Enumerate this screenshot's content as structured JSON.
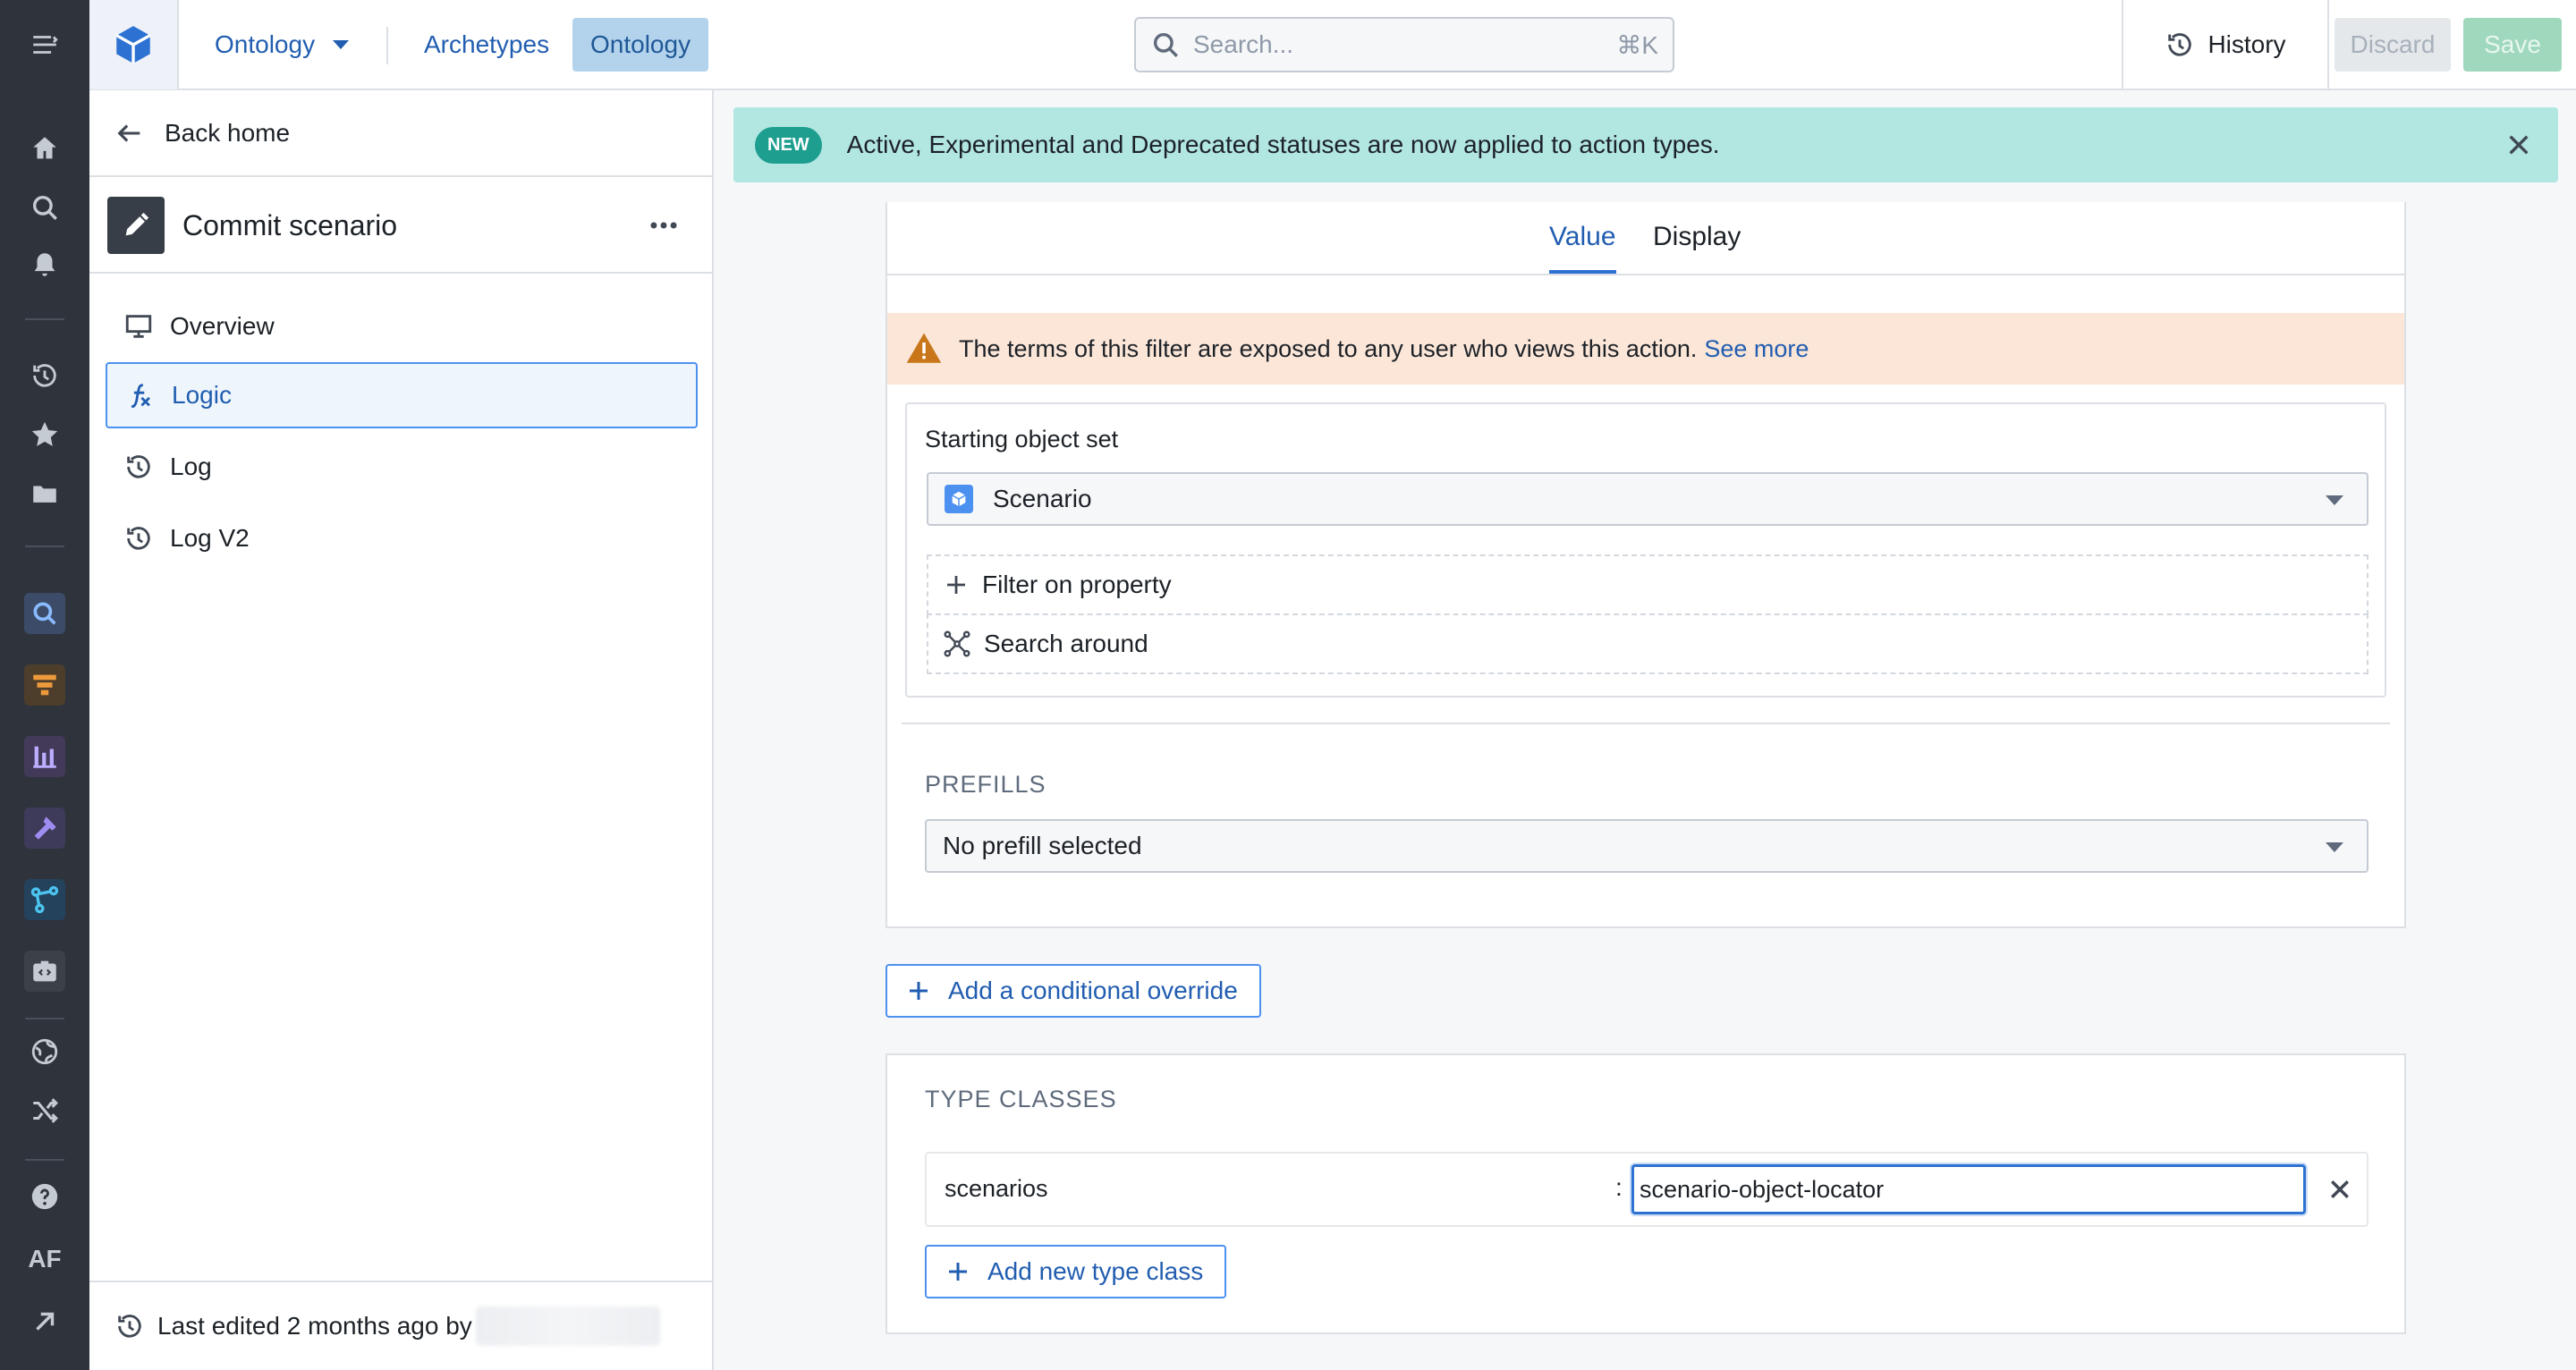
{
  "topbar": {
    "ontology_menu": "Ontology",
    "tab_archetypes": "Archetypes",
    "tab_ontology": "Ontology",
    "search_placeholder": "Search...",
    "search_shortcut": "⌘K",
    "history": "History",
    "discard": "Discard",
    "save": "Save"
  },
  "rail": {
    "initials": "AF",
    "icons": [
      "menu-icon",
      "home-icon",
      "search-icon",
      "bell-icon",
      "history-icon",
      "star-icon",
      "folder-icon",
      "object-explorer-icon",
      "pipeline-icon",
      "analytics-icon",
      "hammer-icon",
      "graph-icon",
      "code-workspace-icon",
      "globe-icon",
      "shuffle-icon",
      "help-icon",
      "external-link-icon"
    ]
  },
  "sidebar": {
    "back": "Back home",
    "action_title": "Commit scenario",
    "items": [
      {
        "label": "Overview",
        "icon": "desktop-icon"
      },
      {
        "label": "Logic",
        "icon": "function-icon",
        "active": true
      },
      {
        "label": "Log",
        "icon": "history-icon"
      },
      {
        "label": "Log V2",
        "icon": "history-icon"
      }
    ],
    "last_edited": "Last edited 2 months ago by"
  },
  "banner": {
    "tag": "NEW",
    "text": "Active, Experimental and Deprecated statuses are now applied to action types."
  },
  "editor": {
    "tabs": [
      "Value",
      "Display"
    ],
    "warning_text": "The terms of this filter are exposed to any user who views this action.",
    "warning_link": "See more",
    "starting_label": "Starting object set",
    "starting_value": "Scenario",
    "filter_on_property": "Filter on property",
    "search_around": "Search around",
    "prefills_label": "PREFILLS",
    "prefills_value": "No prefill selected",
    "add_override": "Add a conditional override"
  },
  "type_classes": {
    "label": "TYPE CLASSES",
    "key": "scenarios",
    "separator": ":",
    "value": "scenario-object-locator",
    "add": "Add new type class"
  },
  "colors": {
    "rail_bg": "#2f343c",
    "accent": "#2d72d2",
    "banner_bg": "#b2e6e1",
    "warning_bg": "#fbe6d8",
    "save_bg": "#9fd8bd"
  }
}
